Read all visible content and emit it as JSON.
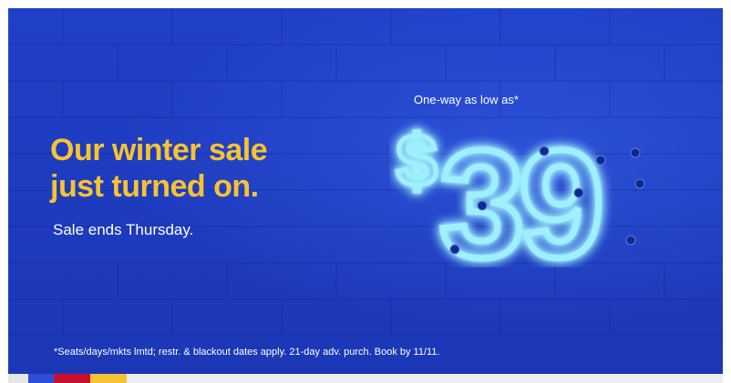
{
  "banner": {
    "headline_line1": "Our winter sale",
    "headline_line2": "just turned on.",
    "subtext": "Sale ends Thursday.",
    "price_label": "One-way as low as*",
    "price_currency": "$",
    "price_amount": "39",
    "disclaimer": "*Seats/days/mkts lmtd; restr. & blackout dates apply. 21-day adv. purch. Book by 11/11."
  },
  "colors": {
    "background": "#1f3fc4",
    "headline": "#f6c331",
    "neon": "#7fe3ff",
    "neon_glow": "#2ea8ff",
    "strip": [
      "#2d4fd8",
      "#c8102e",
      "#f6c331",
      "#e8e8e8"
    ]
  }
}
